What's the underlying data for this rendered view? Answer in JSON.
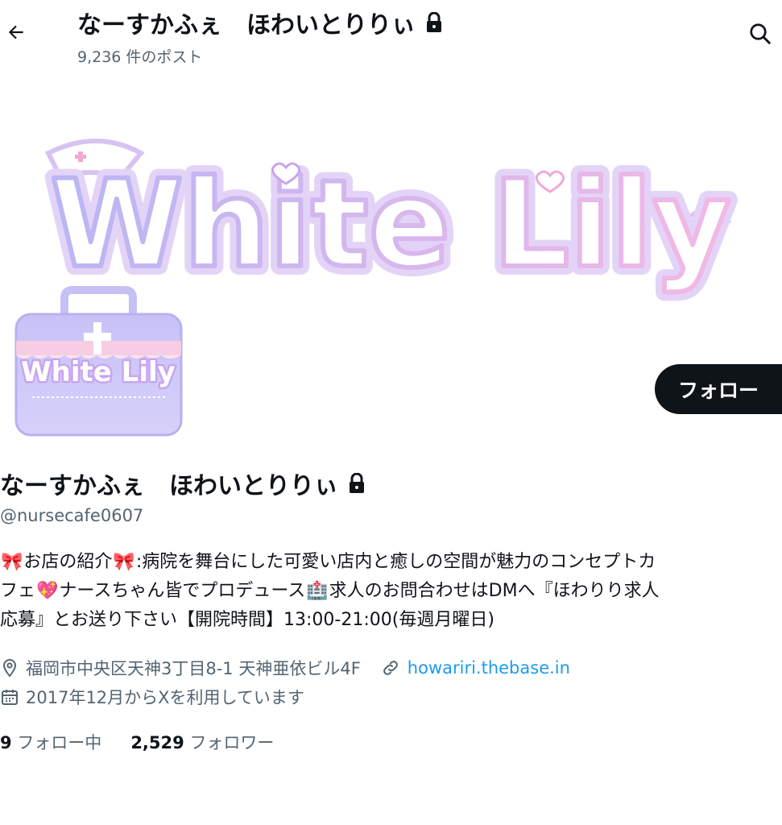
{
  "header": {
    "title": "なーすかふぇ　ほわいとりりぃ",
    "post_count": "9,236 件のポスト",
    "back_icon": "arrow-left-icon",
    "search_icon": "search-icon"
  },
  "banner": {
    "logo_text": "White Lily"
  },
  "avatar": {
    "logo_text": "White Lily"
  },
  "follow_button": "フォロー",
  "profile": {
    "name": "なーすかふぇ　ほわいとりりぃ",
    "handle": "@nursecafe0607",
    "bio_line1": {
      "a": "お店の紹介",
      "b": ":病院を舞台にした可愛い店内と癒しの空間が魅力のコンセプトカ"
    },
    "bio_line2": {
      "a": "フェ",
      "b": "ナースちゃん皆でプロデュース",
      "c": "求人のお問合わせはDMへ『ほわりり求人"
    },
    "bio_line3": "応募』とお送り下さい【開院時間】13:00-21:00(毎週月曜日)",
    "bio_emojis": {
      "ribbon": "🎀",
      "heart": "💖",
      "hospital": "🏥"
    },
    "location": "福岡市中央区天神3丁目8-1 天神亜依ビル4F",
    "website": "howariri.thebase.in",
    "joined": "2017年12月からXを利用しています"
  },
  "stats": {
    "following_count": "9",
    "following_label": "フォロー中",
    "followers_count": "2,529",
    "followers_label": "フォロワー"
  },
  "colors": {
    "text": "#0f1419",
    "secondary": "#536471",
    "link": "#1d9bf0",
    "logo_fill": "#ffffff",
    "logo_outline": "#c9a4f0"
  }
}
